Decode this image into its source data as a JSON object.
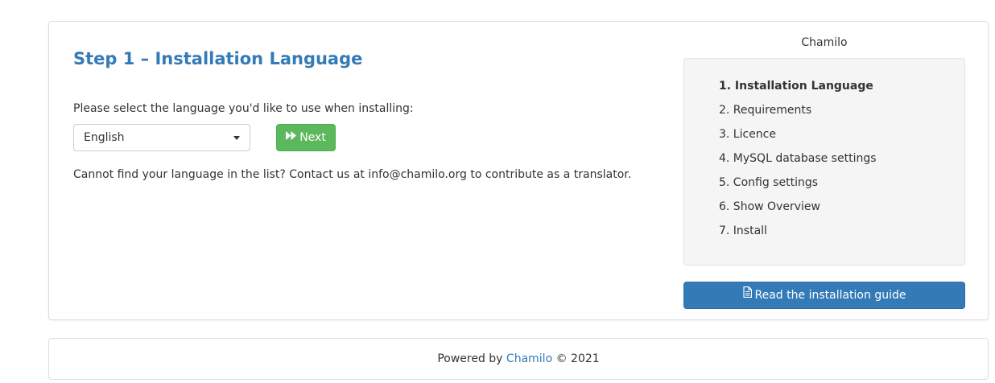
{
  "main": {
    "title": "Step 1 – Installation Language",
    "select_prompt": "Please select the language you'd like to use when installing:",
    "language_select": {
      "value": "English"
    },
    "next_button": {
      "label": "Next",
      "icon": "fast-forward-icon"
    },
    "contact_text": "Cannot find your language in the list? Contact us at info@chamilo.org to contribute as a translator."
  },
  "sidebar": {
    "brand": "Chamilo",
    "steps": [
      {
        "label": "1. Installation Language",
        "active": true
      },
      {
        "label": "2. Requirements",
        "active": false
      },
      {
        "label": "3. Licence",
        "active": false
      },
      {
        "label": "4. MySQL database settings",
        "active": false
      },
      {
        "label": "5. Config settings",
        "active": false
      },
      {
        "label": "6. Show Overview",
        "active": false
      },
      {
        "label": "7. Install",
        "active": false
      }
    ],
    "guide_button": {
      "label": "Read the installation guide",
      "icon": "file-text-icon"
    }
  },
  "footer": {
    "prefix": "Powered by",
    "link_text": "Chamilo",
    "suffix": "© 2021"
  },
  "colors": {
    "title_blue": "#337ab7",
    "success_green": "#5cb85c",
    "primary_blue": "#337ab7",
    "well_bg": "#f5f5f5"
  }
}
